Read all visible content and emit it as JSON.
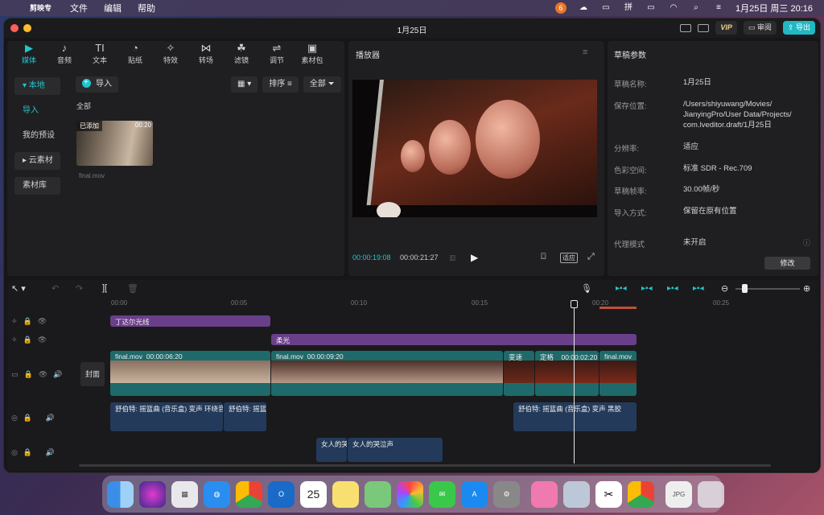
{
  "menubar": {
    "app": "剪映专业版",
    "items": [
      "文件",
      "编辑",
      "帮助"
    ],
    "clock": "1月25日 周三  20:16",
    "badge": "6"
  },
  "window": {
    "title": "1月25日",
    "vip": "VIP",
    "review": "审阅",
    "export": "导出"
  },
  "media_tabs": [
    {
      "label": "媒体",
      "icon": "▶"
    },
    {
      "label": "音频",
      "icon": "♪"
    },
    {
      "label": "文本",
      "icon": "TI"
    },
    {
      "label": "贴纸",
      "icon": "◔"
    },
    {
      "label": "特效",
      "icon": "✧"
    },
    {
      "label": "转场",
      "icon": "⋈"
    },
    {
      "label": "滤镜",
      "icon": "☘"
    },
    {
      "label": "调节",
      "icon": "⇌"
    },
    {
      "label": "素材包",
      "icon": "▣"
    }
  ],
  "sidebar": {
    "local": "▾ 本地",
    "import": "导入",
    "preset": "我的预设",
    "cloud": "▸ 云素材",
    "library": "素材库"
  },
  "media": {
    "import_btn": "导入",
    "all_label": "全部",
    "sort": "排序",
    "filter": "全部",
    "thumb_tag": "已添加",
    "thumb_dur": "00:20",
    "file": "final.mov"
  },
  "player": {
    "title": "播放器",
    "current": "00:00:19:08",
    "total": "00:00:21:27",
    "fit": "适应"
  },
  "params": {
    "title": "草稿参数",
    "rows": [
      {
        "k": "草稿名称:",
        "v": "1月25日"
      },
      {
        "k": "保存位置:",
        "v": "/Users/shiyuwang/Movies/"
      },
      {
        "k": "",
        "v": "JianyingPro/User Data/Projects/"
      },
      {
        "k": "",
        "v": "com.lveditor.draft/1月25日"
      },
      {
        "k": "分辨率:",
        "v": "适应"
      },
      {
        "k": "色彩空间:",
        "v": "标准 SDR - Rec.709"
      },
      {
        "k": "草稿帧率:",
        "v": "30.00帧/秒"
      },
      {
        "k": "导入方式:",
        "v": "保留在原有位置"
      },
      {
        "k": "代理模式",
        "v": "未开启"
      }
    ],
    "edit": "修改"
  },
  "timeline": {
    "ticks": [
      "00:00",
      "00:05",
      "00:10",
      "00:15",
      "00:20",
      "00:25"
    ],
    "fx1": "丁达尔光线",
    "fx2": "柔光",
    "cover": "封面",
    "v1_name": "final.mov",
    "v1_dur": "00:00:06:20",
    "v2_name": "final.mov",
    "v2_dur": "00:00:09:20",
    "v3": "变速",
    "v4": "定格",
    "v4_dur": "00:00:02:20",
    "v5": "final.mov",
    "a1": "舒伯特: 摇篮曲 (音乐盒)   变声 环绕音",
    "a2": "舒伯特: 摇篮曲",
    "a3": "舒伯特: 摇篮曲 (音乐盒)   变声 黑胶",
    "a4": "女人的哭",
    "a5": "女人的哭泣声"
  },
  "dock": [
    "Finder",
    "Siri",
    "Launchpad",
    "Safari",
    "Chrome",
    "Outlook",
    "Calendar",
    "Notes",
    "Maps",
    "Photos",
    "Messages",
    "App Store",
    "Settings",
    "Remote",
    "Preview",
    "CapCut",
    "Chrome",
    "JPG",
    "Trash"
  ]
}
